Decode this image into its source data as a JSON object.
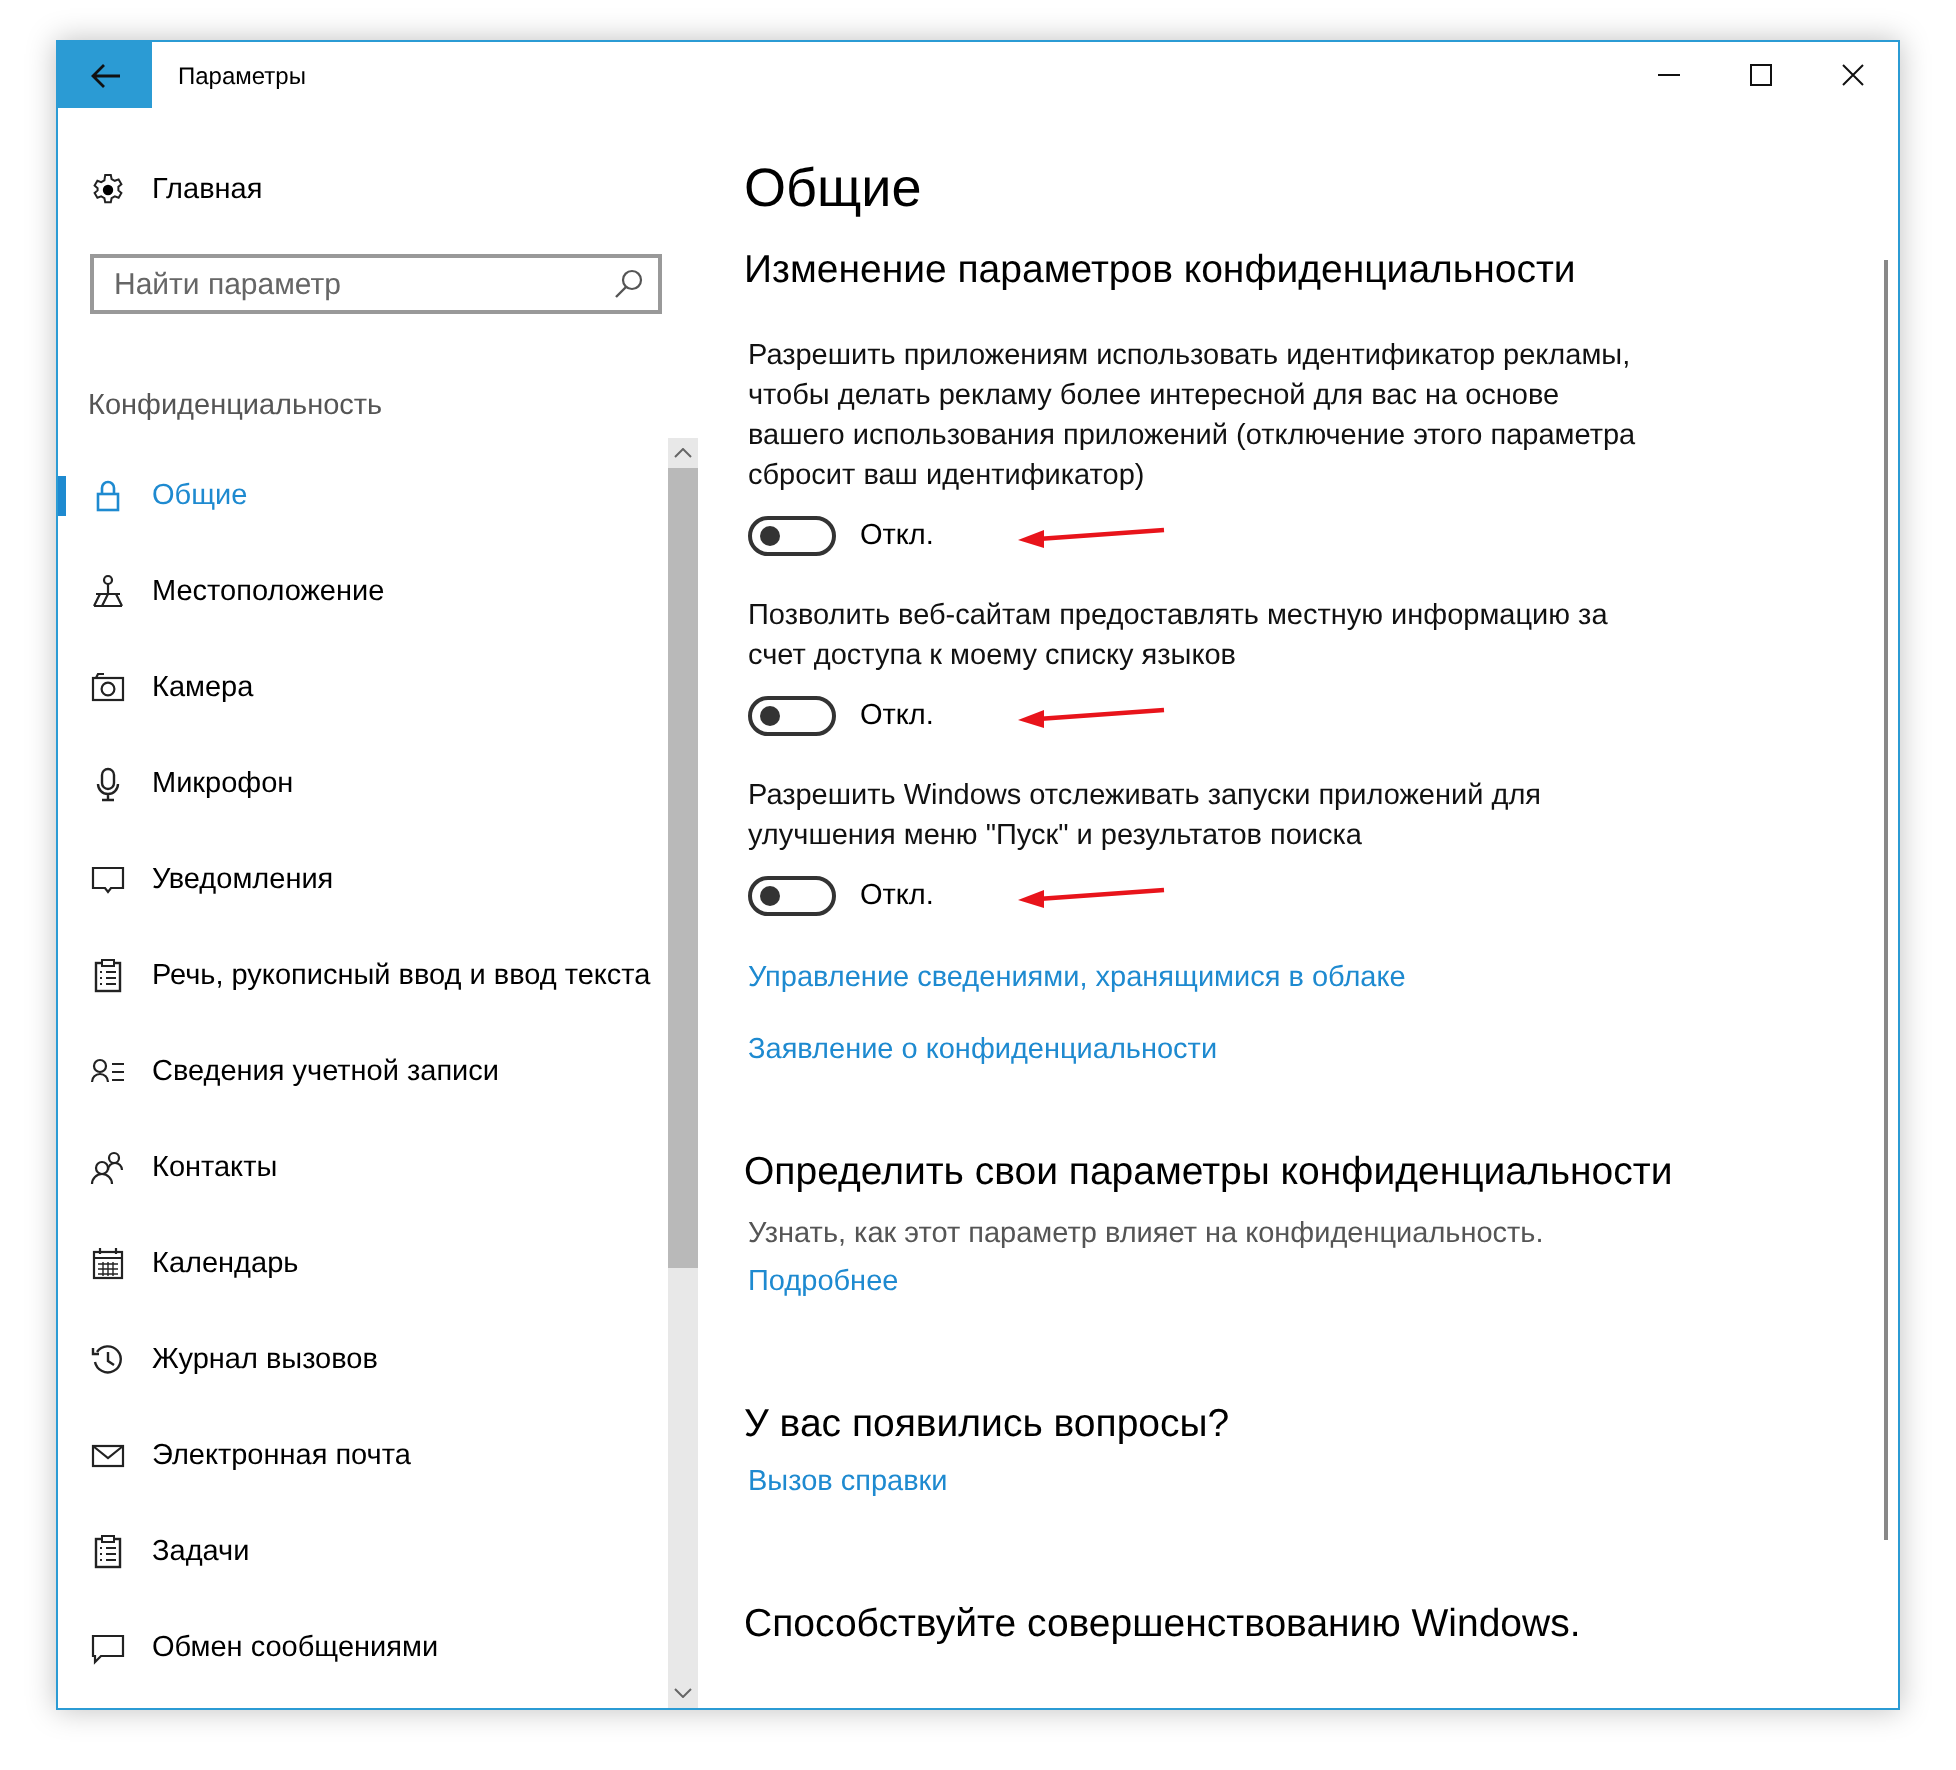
{
  "window": {
    "title": "Параметры"
  },
  "sidebar": {
    "home": "Главная",
    "search": {
      "placeholder": "Найти параметр"
    },
    "category": "Конфиденциальность",
    "items": [
      {
        "label": "Общие",
        "selected": true
      },
      {
        "label": "Местоположение",
        "selected": false
      },
      {
        "label": "Камера",
        "selected": false
      },
      {
        "label": "Микрофон",
        "selected": false
      },
      {
        "label": "Уведомления",
        "selected": false
      },
      {
        "label": "Речь, рукописный ввод и ввод текста",
        "selected": false
      },
      {
        "label": "Сведения учетной записи",
        "selected": false
      },
      {
        "label": "Контакты",
        "selected": false
      },
      {
        "label": "Календарь",
        "selected": false
      },
      {
        "label": "Журнал вызовов",
        "selected": false
      },
      {
        "label": "Электронная почта",
        "selected": false
      },
      {
        "label": "Задачи",
        "selected": false
      },
      {
        "label": "Обмен сообщениями",
        "selected": false
      }
    ]
  },
  "main": {
    "title": "Общие",
    "section_title": "Изменение параметров конфиденциальности",
    "settings": [
      {
        "description": "Разрешить приложениям использовать идентификатор рекламы, чтобы делать рекламу более интересной для вас на основе вашего использования приложений (отключение этого параметра сбросит ваш идентификатор)",
        "on": false,
        "state_label": "Откл.",
        "marked": true
      },
      {
        "description": "Позволить веб-сайтам предоставлять местную информацию за счет доступа к моему списку языков",
        "on": false,
        "state_label": "Откл.",
        "marked": true
      },
      {
        "description": "Разрешить Windows отслеживать запуски приложений для улучшения меню \"Пуск\" и результатов поиска",
        "on": false,
        "state_label": "Откл.",
        "marked": true
      }
    ],
    "links": [
      "Управление сведениями, хранящимися в облаке",
      "Заявление о конфиденциальности"
    ],
    "sections": [
      {
        "title": "Определить свои параметры конфиденциальности",
        "text": "Узнать, как этот параметр влияет на конфиденциальность.",
        "link": "Подробнее"
      },
      {
        "title": "У вас появились вопросы?",
        "link": "Вызов справки"
      },
      {
        "title": "Способствуйте совершенствованию Windows."
      }
    ]
  }
}
